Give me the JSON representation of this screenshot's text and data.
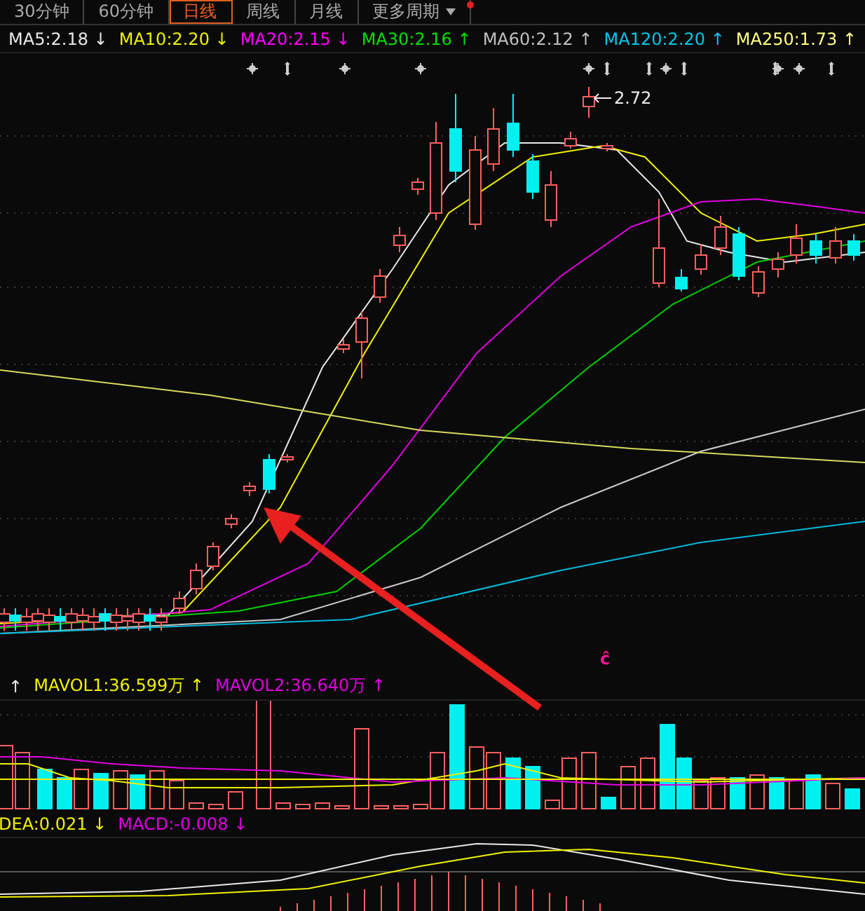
{
  "tabs": [
    {
      "label": "30分钟",
      "selected": false
    },
    {
      "label": "60分钟",
      "selected": false
    },
    {
      "label": "日线",
      "selected": true
    },
    {
      "label": "周线",
      "selected": false
    },
    {
      "label": "月线",
      "selected": false
    },
    {
      "label": "更多周期",
      "selected": false,
      "dropdown": true,
      "alert": true
    }
  ],
  "ma_legend": [
    {
      "text": "MA5:2.18",
      "arrow": "↓",
      "color": "#e8e8e8"
    },
    {
      "text": "MA10:2.20",
      "arrow": "↓",
      "color": "#f0f000"
    },
    {
      "text": "MA20:2.15",
      "arrow": "↓",
      "color": "#ff00ff"
    },
    {
      "text": "MA30:2.16",
      "arrow": "↑",
      "color": "#00e000"
    },
    {
      "text": "MA60:2.12",
      "arrow": "↑",
      "color": "#c0c0c0"
    },
    {
      "text": "MA120:2.20",
      "arrow": "↑",
      "color": "#00c8e8"
    },
    {
      "text": "MA250:1.73",
      "arrow": "↑",
      "color": "#ffff80"
    }
  ],
  "price_chart": {
    "high_label": "2.72",
    "marker": "ĉ"
  },
  "volume_legend": {
    "lead_arrow": "↑",
    "items": [
      {
        "text": "MAVOL1:36.599万",
        "arrow": "↑",
        "color": "#f0f000"
      },
      {
        "text": "MAVOL2:36.640万",
        "arrow": "↑",
        "color": "#e000e0"
      }
    ]
  },
  "macd_legend": [
    {
      "text": "DEA:0.021",
      "arrow": "↓",
      "color": "#f0f000"
    },
    {
      "text": "MACD:-0.008",
      "arrow": "↓",
      "color": "#e000e0"
    }
  ]
}
